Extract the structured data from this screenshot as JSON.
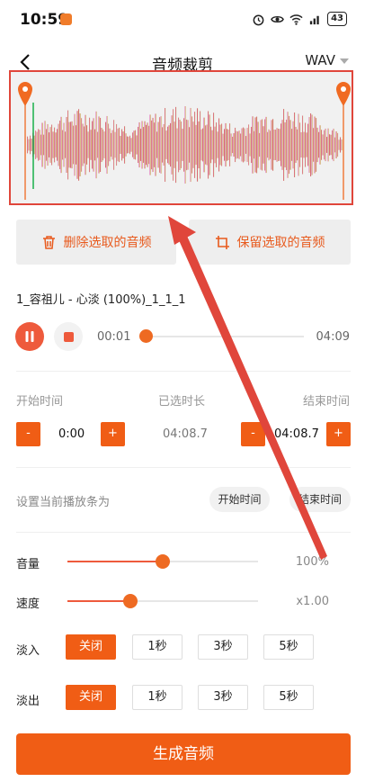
{
  "status": {
    "time": "10:59",
    "battery": "43"
  },
  "header": {
    "title": "音频裁剪",
    "format": "WAV"
  },
  "selection": {
    "delete_label": "删除选取的音频",
    "keep_label": "保留选取的音频"
  },
  "file": {
    "name": "1_容祖儿 - 心淡 (100%)_1_1_1"
  },
  "player": {
    "current_time": "00:01",
    "total_time": "04:09",
    "progress": 0.0
  },
  "range": {
    "start_label": "开始时间",
    "selected_label": "已选时长",
    "end_label": "结束时间",
    "start_value": "0:00",
    "selected_value": "04:08.7",
    "end_value": "04:08.7",
    "minus": "-",
    "plus": "+"
  },
  "set_progress": {
    "label": "设置当前播放条为",
    "start_btn": "开始时间",
    "end_btn": "结束时间"
  },
  "volume": {
    "label": "音量",
    "value": "100%",
    "level": 0.5
  },
  "speed": {
    "label": "速度",
    "value": "x1.00",
    "level": 0.33
  },
  "fade_in": {
    "label": "淡入",
    "options": [
      "关闭",
      "1秒",
      "3秒",
      "5秒"
    ],
    "selected": "关闭"
  },
  "fade_out": {
    "label": "淡出",
    "options": [
      "关闭",
      "1秒",
      "3秒",
      "5秒"
    ],
    "selected": "关闭"
  },
  "generate": {
    "label": "生成音频"
  },
  "colors": {
    "accent": "#f05d15",
    "annotation": "#e0463b"
  }
}
